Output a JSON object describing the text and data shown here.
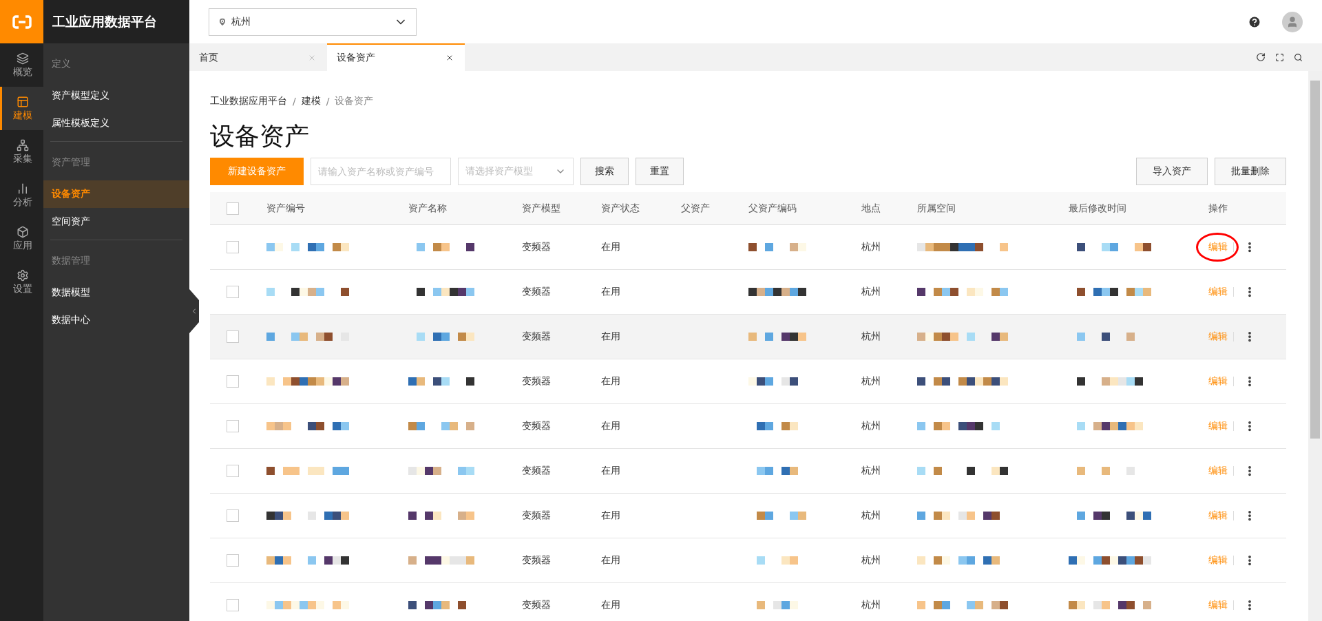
{
  "app_title": "工业应用数据平台",
  "rail": [
    {
      "label": "概览",
      "selected": false
    },
    {
      "label": "建模",
      "selected": true
    },
    {
      "label": "采集",
      "selected": false
    },
    {
      "label": "分析",
      "selected": false
    },
    {
      "label": "应用",
      "selected": false
    },
    {
      "label": "设置",
      "selected": false
    }
  ],
  "menu": [
    {
      "heading": "定义",
      "items": [
        {
          "label": "资产模型定义",
          "selected": false
        },
        {
          "label": "属性模板定义",
          "selected": false
        }
      ]
    },
    {
      "heading": "资产管理",
      "items": [
        {
          "label": "设备资产",
          "selected": true
        },
        {
          "label": "空间资产",
          "selected": false
        }
      ]
    },
    {
      "heading": "数据管理",
      "items": [
        {
          "label": "数据模型",
          "selected": false
        },
        {
          "label": "数据中心",
          "selected": false
        }
      ]
    }
  ],
  "location_select": {
    "value": "杭州"
  },
  "tabs": [
    {
      "label": "首页",
      "selected": false
    },
    {
      "label": "设备资产",
      "selected": true
    }
  ],
  "breadcrumb": {
    "separator": "/",
    "items": [
      "工业数据应用平台",
      "建模",
      "设备资产"
    ]
  },
  "page_title": "设备资产",
  "toolbar": {
    "create_button": "新建设备资产",
    "search_placeholder": "请输入资产名称或资产编号",
    "model_placeholder": "请选择资产模型",
    "search_button": "搜索",
    "reset_button": "重置",
    "import_button": "导入资产",
    "delete_button": "批量删除"
  },
  "table": {
    "header_checked": false,
    "columns": [
      "资产编号",
      "资产名称",
      "资产模型",
      "资产状态",
      "父资产",
      "父资产编码",
      "地点",
      "所属空间",
      "最后修改时间",
      "操作"
    ],
    "rows": [
      {
        "checked": false,
        "highlighted": false,
        "model": "变频器",
        "status": "在用",
        "location": "杭州",
        "action": "编辑",
        "circled": true
      },
      {
        "checked": false,
        "highlighted": false,
        "model": "变频器",
        "status": "在用",
        "location": "杭州",
        "action": "编辑",
        "circled": false
      },
      {
        "checked": false,
        "highlighted": true,
        "model": "变频器",
        "status": "在用",
        "location": "杭州",
        "action": "编辑",
        "circled": false
      },
      {
        "checked": false,
        "highlighted": false,
        "model": "变频器",
        "status": "在用",
        "location": "杭州",
        "action": "编辑",
        "circled": false
      },
      {
        "checked": false,
        "highlighted": false,
        "model": "变频器",
        "status": "在用",
        "location": "杭州",
        "action": "编辑",
        "circled": false
      },
      {
        "checked": false,
        "highlighted": false,
        "model": "变频器",
        "status": "在用",
        "location": "杭州",
        "action": "编辑",
        "circled": false
      },
      {
        "checked": false,
        "highlighted": false,
        "model": "变频器",
        "status": "在用",
        "location": "杭州",
        "action": "编辑",
        "circled": false
      },
      {
        "checked": false,
        "highlighted": false,
        "model": "变频器",
        "status": "在用",
        "location": "杭州",
        "action": "编辑",
        "circled": false
      },
      {
        "checked": false,
        "highlighted": false,
        "model": "变频器",
        "status": "在用",
        "location": "杭州",
        "action": "编辑",
        "circled": false
      }
    ]
  }
}
